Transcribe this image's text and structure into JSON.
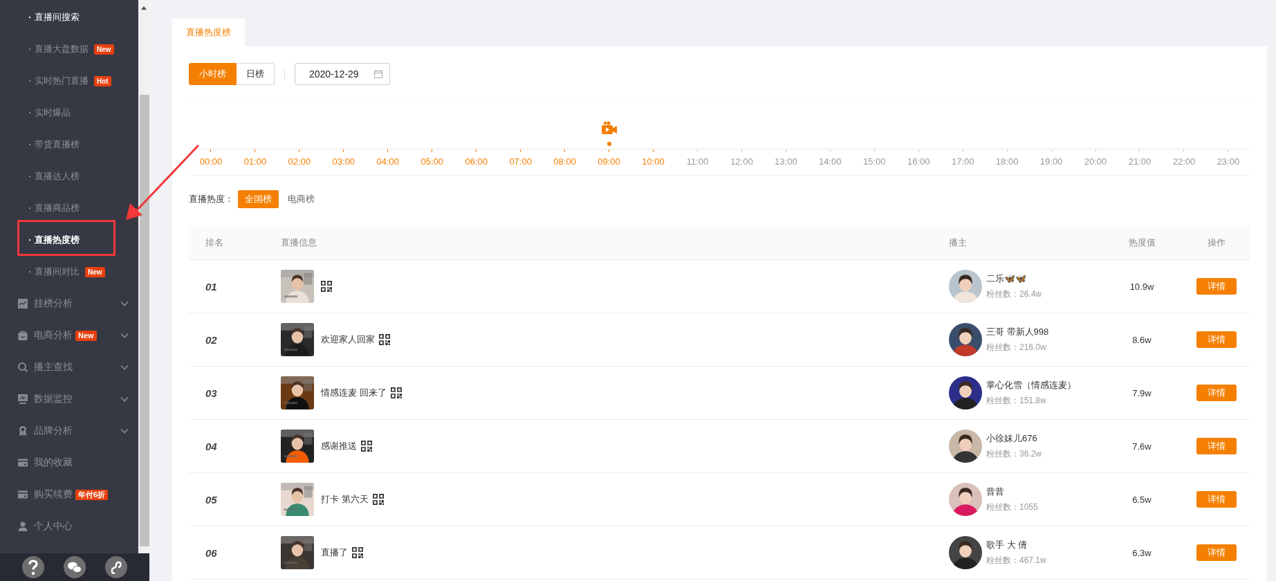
{
  "sidebar": {
    "sub_items": [
      {
        "label": "直播间搜索",
        "hover": true,
        "selected": false
      },
      {
        "label": "直播大盘数据",
        "badge": "New",
        "hover": false,
        "selected": false
      },
      {
        "label": "实时热门直播",
        "badge": "Hot",
        "hover": false,
        "selected": false
      },
      {
        "label": "实时爆品",
        "hover": false,
        "selected": false
      },
      {
        "label": "带货直播榜",
        "hover": false,
        "selected": false
      },
      {
        "label": "直播达人榜",
        "hover": false,
        "selected": false
      },
      {
        "label": "直播商品榜",
        "hover": false,
        "selected": false
      },
      {
        "label": "直播热度榜",
        "hover": false,
        "selected": true
      },
      {
        "label": "直播间对比",
        "badge": "New",
        "hover": false,
        "selected": false
      }
    ],
    "menu_items": [
      {
        "label": "挂榜分析",
        "expandable": true
      },
      {
        "label": "电商分析",
        "badge": "New",
        "expandable": true
      },
      {
        "label": "播主查找",
        "expandable": true
      },
      {
        "label": "数据监控",
        "expandable": true
      },
      {
        "label": "品牌分析",
        "expandable": true
      },
      {
        "label": "我的收藏",
        "expandable": false
      },
      {
        "label": "购买续费",
        "badge": "年付6折",
        "expandable": false
      },
      {
        "label": "个人中心",
        "expandable": false
      }
    ]
  },
  "tabs": [
    {
      "label": "直播热度榜",
      "selected": true
    }
  ],
  "period_tabs": [
    {
      "label": "小时榜",
      "selected": true
    },
    {
      "label": "日榜",
      "selected": false
    }
  ],
  "date_field": {
    "value": "2020-12-29"
  },
  "hours": [
    {
      "label": "00:00",
      "active": true,
      "selected": false
    },
    {
      "label": "01:00",
      "active": true,
      "selected": false
    },
    {
      "label": "02:00",
      "active": true,
      "selected": false
    },
    {
      "label": "03:00",
      "active": true,
      "selected": false
    },
    {
      "label": "04:00",
      "active": true,
      "selected": false
    },
    {
      "label": "05:00",
      "active": true,
      "selected": false
    },
    {
      "label": "06:00",
      "active": true,
      "selected": false
    },
    {
      "label": "07:00",
      "active": true,
      "selected": false
    },
    {
      "label": "08:00",
      "active": true,
      "selected": false
    },
    {
      "label": "09:00",
      "active": true,
      "selected": true
    },
    {
      "label": "10:00",
      "active": true,
      "selected": false
    },
    {
      "label": "11:00",
      "active": false,
      "selected": false
    },
    {
      "label": "12:00",
      "active": false,
      "selected": false
    },
    {
      "label": "13:00",
      "active": false,
      "selected": false
    },
    {
      "label": "14:00",
      "active": false,
      "selected": false
    },
    {
      "label": "15:00",
      "active": false,
      "selected": false
    },
    {
      "label": "16:00",
      "active": false,
      "selected": false
    },
    {
      "label": "17:00",
      "active": false,
      "selected": false
    },
    {
      "label": "18:00",
      "active": false,
      "selected": false
    },
    {
      "label": "19:00",
      "active": false,
      "selected": false
    },
    {
      "label": "20:00",
      "active": false,
      "selected": false
    },
    {
      "label": "21:00",
      "active": false,
      "selected": false
    },
    {
      "label": "22:00",
      "active": false,
      "selected": false
    },
    {
      "label": "23:00",
      "active": false,
      "selected": false
    }
  ],
  "heat_filter": {
    "label": "直播热度：",
    "options": [
      {
        "label": "全国榜",
        "selected": true
      },
      {
        "label": "电商榜",
        "selected": false
      }
    ]
  },
  "table": {
    "columns": [
      "排名",
      "直播信息",
      "播主",
      "热度值",
      "操作"
    ],
    "rows": [
      {
        "rank": "01",
        "host": "二乐🦋🦋",
        "fans": "粉丝数：26.4w",
        "heat": "10.9w",
        "action": "详情"
      },
      {
        "rank": "02",
        "title": "欢迎家人回家",
        "host": "三哥 带新人998",
        "fans": "粉丝数：216.0w",
        "heat": "8.6w",
        "action": "详情"
      },
      {
        "rank": "03",
        "title": "情感连麦 回来了",
        "host": "掌心化雪（情感连麦）",
        "fans": "粉丝数：151.8w",
        "heat": "7.9w",
        "action": "详情"
      },
      {
        "rank": "04",
        "title": "感谢推送",
        "host": "小徐妹儿676",
        "fans": "粉丝数：36.2w",
        "heat": "7.6w",
        "action": "详情"
      },
      {
        "rank": "05",
        "title": "打卡 第六天",
        "host": "昔昔",
        "fans": "粉丝数：1055",
        "heat": "6.5w",
        "action": "详情"
      },
      {
        "rank": "06",
        "title": "直播了",
        "host": "歌手 大 倩",
        "fans": "粉丝数：467.1w",
        "heat": "6.3w",
        "action": "详情"
      }
    ]
  }
}
